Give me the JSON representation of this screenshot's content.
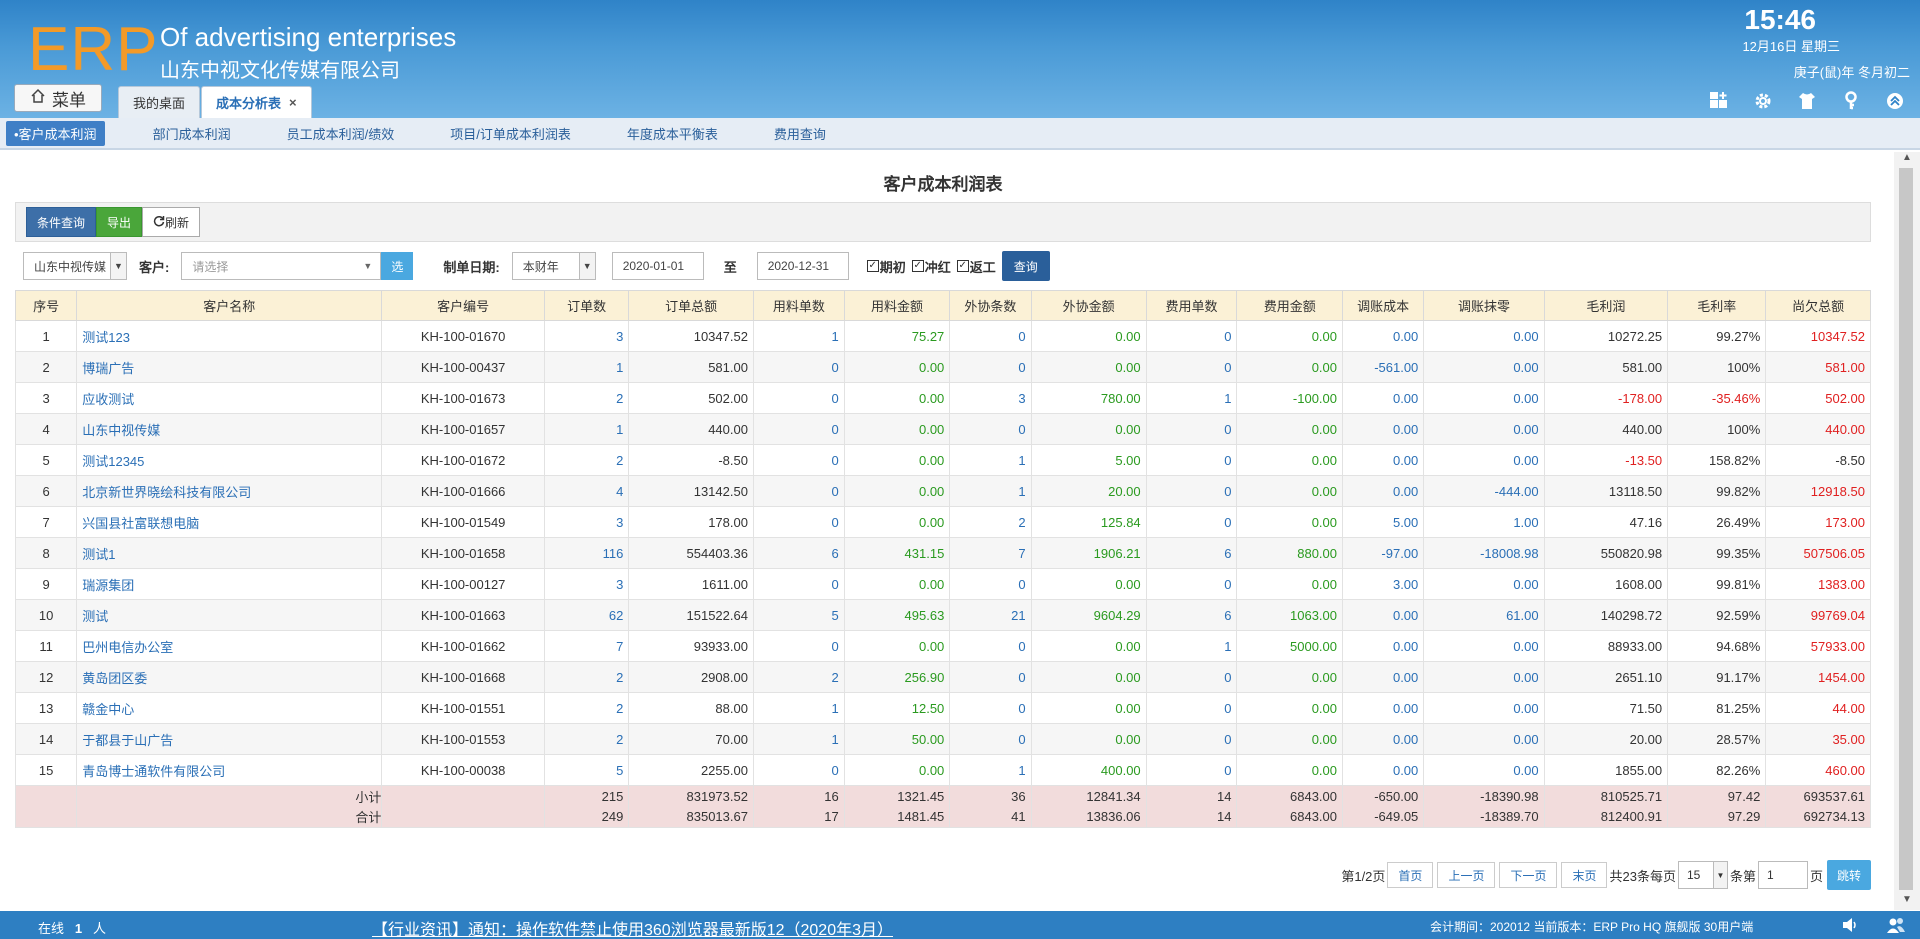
{
  "header": {
    "logo": "ERP",
    "company_en": "Of advertising enterprises",
    "company_cn": "山东中视文化传媒有限公司",
    "time": "15:46",
    "date": "12月16日 星期三",
    "lunar": "庚子(鼠)年 冬月初二",
    "menu_label": "菜单",
    "tabs": [
      {
        "label": "我的桌面"
      },
      {
        "label": "成本分析表",
        "close": "×"
      }
    ]
  },
  "subnav": {
    "items": [
      "•客户成本利润",
      "部门成本利润",
      "员工成本利润/绩效",
      "项目/订单成本利润表",
      "年度成本平衡表",
      "费用查询"
    ]
  },
  "page_title": "客户成本利润表",
  "toolbar": {
    "search_label": "条件查询",
    "export_label": "导出",
    "refresh_label": "刷新"
  },
  "filter": {
    "company_value": "山东中视传媒",
    "customer_label": "客户:",
    "customer_placeholder": "请选择",
    "pick_label": "选",
    "date_label": "制单日期:",
    "period_value": "本财年",
    "date_from": "2020-01-01",
    "to_label": "至",
    "date_to": "2020-12-31",
    "check1": "期初",
    "check2": "冲红",
    "check3": "返工",
    "query_label": "查询"
  },
  "table": {
    "headers": [
      "序号",
      "客户名称",
      "客户编号",
      "订单数",
      "订单总额",
      "用料单数",
      "用料金额",
      "外协条数",
      "外协金额",
      "费用单数",
      "费用金额",
      "调账成本",
      "调账抹零",
      "毛利润",
      "毛利率",
      "尚欠总额"
    ],
    "rows": [
      [
        "1",
        "测试123",
        "KH-100-01670",
        "3",
        "10347.52",
        "1",
        "75.27",
        "0",
        "0.00",
        "0",
        "0.00",
        "0.00",
        "0.00",
        "10272.25",
        "99.27%",
        "10347.52"
      ],
      [
        "2",
        "博瑞广告",
        "KH-100-00437",
        "1",
        "581.00",
        "0",
        "0.00",
        "0",
        "0.00",
        "0",
        "0.00",
        "-561.00",
        "0.00",
        "581.00",
        "100%",
        "581.00"
      ],
      [
        "3",
        "应收测试",
        "KH-100-01673",
        "2",
        "502.00",
        "0",
        "0.00",
        "3",
        "780.00",
        "1",
        "-100.00",
        "0.00",
        "0.00",
        "-178.00",
        "-35.46%",
        "502.00"
      ],
      [
        "4",
        "山东中视传媒",
        "KH-100-01657",
        "1",
        "440.00",
        "0",
        "0.00",
        "0",
        "0.00",
        "0",
        "0.00",
        "0.00",
        "0.00",
        "440.00",
        "100%",
        "440.00"
      ],
      [
        "5",
        "测试12345",
        "KH-100-01672",
        "2",
        "-8.50",
        "0",
        "0.00",
        "1",
        "5.00",
        "0",
        "0.00",
        "0.00",
        "0.00",
        "-13.50",
        "158.82%",
        "-8.50"
      ],
      [
        "6",
        "北京新世界晓绘科技有限公司",
        "KH-100-01666",
        "4",
        "13142.50",
        "0",
        "0.00",
        "1",
        "20.00",
        "0",
        "0.00",
        "0.00",
        "-444.00",
        "13118.50",
        "99.82%",
        "12918.50"
      ],
      [
        "7",
        "兴国县社富联想电脑",
        "KH-100-01549",
        "3",
        "178.00",
        "0",
        "0.00",
        "2",
        "125.84",
        "0",
        "0.00",
        "5.00",
        "1.00",
        "47.16",
        "26.49%",
        "173.00"
      ],
      [
        "8",
        "测试1",
        "KH-100-01658",
        "116",
        "554403.36",
        "6",
        "431.15",
        "7",
        "1906.21",
        "6",
        "880.00",
        "-97.00",
        "-18008.98",
        "550820.98",
        "99.35%",
        "507506.05"
      ],
      [
        "9",
        "瑞源集团",
        "KH-100-00127",
        "3",
        "1611.00",
        "0",
        "0.00",
        "0",
        "0.00",
        "0",
        "0.00",
        "3.00",
        "0.00",
        "1608.00",
        "99.81%",
        "1383.00"
      ],
      [
        "10",
        "测试",
        "KH-100-01663",
        "62",
        "151522.64",
        "5",
        "495.63",
        "21",
        "9604.29",
        "6",
        "1063.00",
        "0.00",
        "61.00",
        "140298.72",
        "92.59%",
        "99769.04"
      ],
      [
        "11",
        "巴州电信办公室",
        "KH-100-01662",
        "7",
        "93933.00",
        "0",
        "0.00",
        "0",
        "0.00",
        "1",
        "5000.00",
        "0.00",
        "0.00",
        "88933.00",
        "94.68%",
        "57933.00"
      ],
      [
        "12",
        "黄岛团区委",
        "KH-100-01668",
        "2",
        "2908.00",
        "2",
        "256.90",
        "0",
        "0.00",
        "0",
        "0.00",
        "0.00",
        "0.00",
        "2651.10",
        "91.17%",
        "1454.00"
      ],
      [
        "13",
        "赣金中心",
        "KH-100-01551",
        "2",
        "88.00",
        "1",
        "12.50",
        "0",
        "0.00",
        "0",
        "0.00",
        "0.00",
        "0.00",
        "71.50",
        "81.25%",
        "44.00"
      ],
      [
        "14",
        "于都县于山广告",
        "KH-100-01553",
        "2",
        "70.00",
        "1",
        "50.00",
        "0",
        "0.00",
        "0",
        "0.00",
        "0.00",
        "0.00",
        "20.00",
        "28.57%",
        "35.00"
      ],
      [
        "15",
        "青岛博士通软件有限公司",
        "KH-100-00038",
        "5",
        "2255.00",
        "0",
        "0.00",
        "1",
        "400.00",
        "0",
        "0.00",
        "0.00",
        "0.00",
        "1855.00",
        "82.26%",
        "460.00"
      ]
    ],
    "subtotal": [
      "小计",
      "215",
      "831973.52",
      "16",
      "1321.45",
      "36",
      "12841.34",
      "14",
      "6843.00",
      "-650.00",
      "-18390.98",
      "810525.71",
      "97.42",
      "693537.61"
    ],
    "total": [
      "合计",
      "249",
      "835013.67",
      "17",
      "1481.45",
      "41",
      "13836.06",
      "14",
      "6843.00",
      "-649.05",
      "-18389.70",
      "812400.91",
      "97.29",
      "692734.13"
    ]
  },
  "pager": {
    "page_info": "第1/2页",
    "first": "首页",
    "prev": "上一页",
    "next": "下一页",
    "last": "末页",
    "count_text": "共23条每页",
    "per_page": "15",
    "per_page_unit": "条第",
    "page_input": "1",
    "page_unit": "页",
    "jump": "跳转"
  },
  "footer": {
    "online_label": "在线",
    "online_count": "1",
    "online_unit": "人",
    "news": "【行业资讯】通知：操作软件禁止使用360浏览器最新版12（2020年3月）",
    "info": "会计期间：202012 当前版本：ERP Pro HQ 旗舰版 30用户端"
  },
  "colors": {
    "header_blue": "#2f83c8",
    "logo_orange": "#f39a28",
    "link_blue": "#2a6fb6",
    "green": "#2a9a1f",
    "red": "#e02020",
    "sum_bg": "#f2dcdc",
    "thead_bg": "#fbf1d6"
  }
}
